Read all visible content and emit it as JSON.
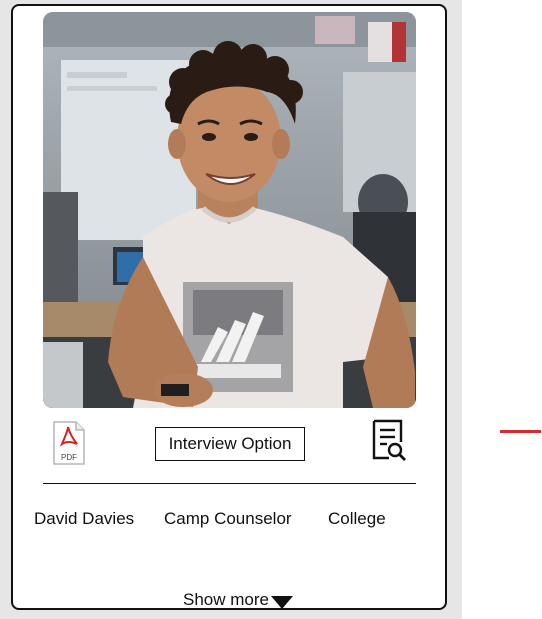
{
  "card": {
    "pdf_icon": {
      "icon": "pdf-icon",
      "label": "PDF",
      "accent": "#d8231f"
    },
    "interview_button": {
      "label": "Interview Option"
    },
    "search_icon": {
      "icon": "document-search-icon"
    },
    "profile": {
      "name": "David Davies",
      "role": "Camp Counselor",
      "level": "College"
    },
    "show_more": {
      "label": "Show more",
      "icon": "triangle-down-icon"
    }
  },
  "colors": {
    "border": "#111111",
    "panel_background": "#e6e6e6",
    "accent_red": "#d62b2b"
  }
}
